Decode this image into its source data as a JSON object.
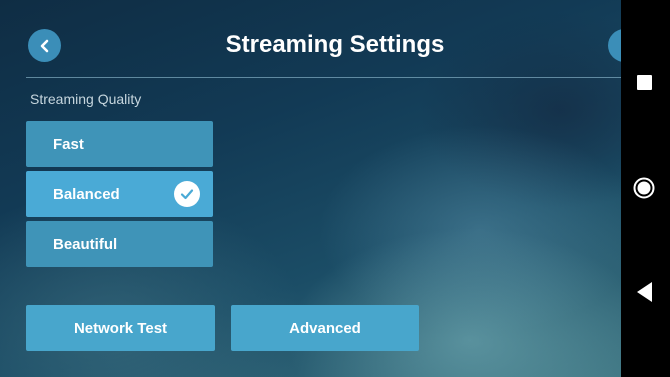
{
  "header": {
    "title": "Streaming Settings",
    "back_icon": "chevron-left-icon"
  },
  "quality": {
    "label": "Streaming Quality",
    "options": [
      {
        "label": "Fast",
        "selected": false
      },
      {
        "label": "Balanced",
        "selected": true
      },
      {
        "label": "Beautiful",
        "selected": false
      }
    ]
  },
  "actions": {
    "network_test": "Network Test",
    "advanced": "Advanced"
  },
  "navbar": {
    "icons": [
      "recents-icon",
      "home-icon",
      "back-icon"
    ]
  },
  "colors": {
    "accent": "#4aaad6",
    "button": "#3f94b8"
  }
}
